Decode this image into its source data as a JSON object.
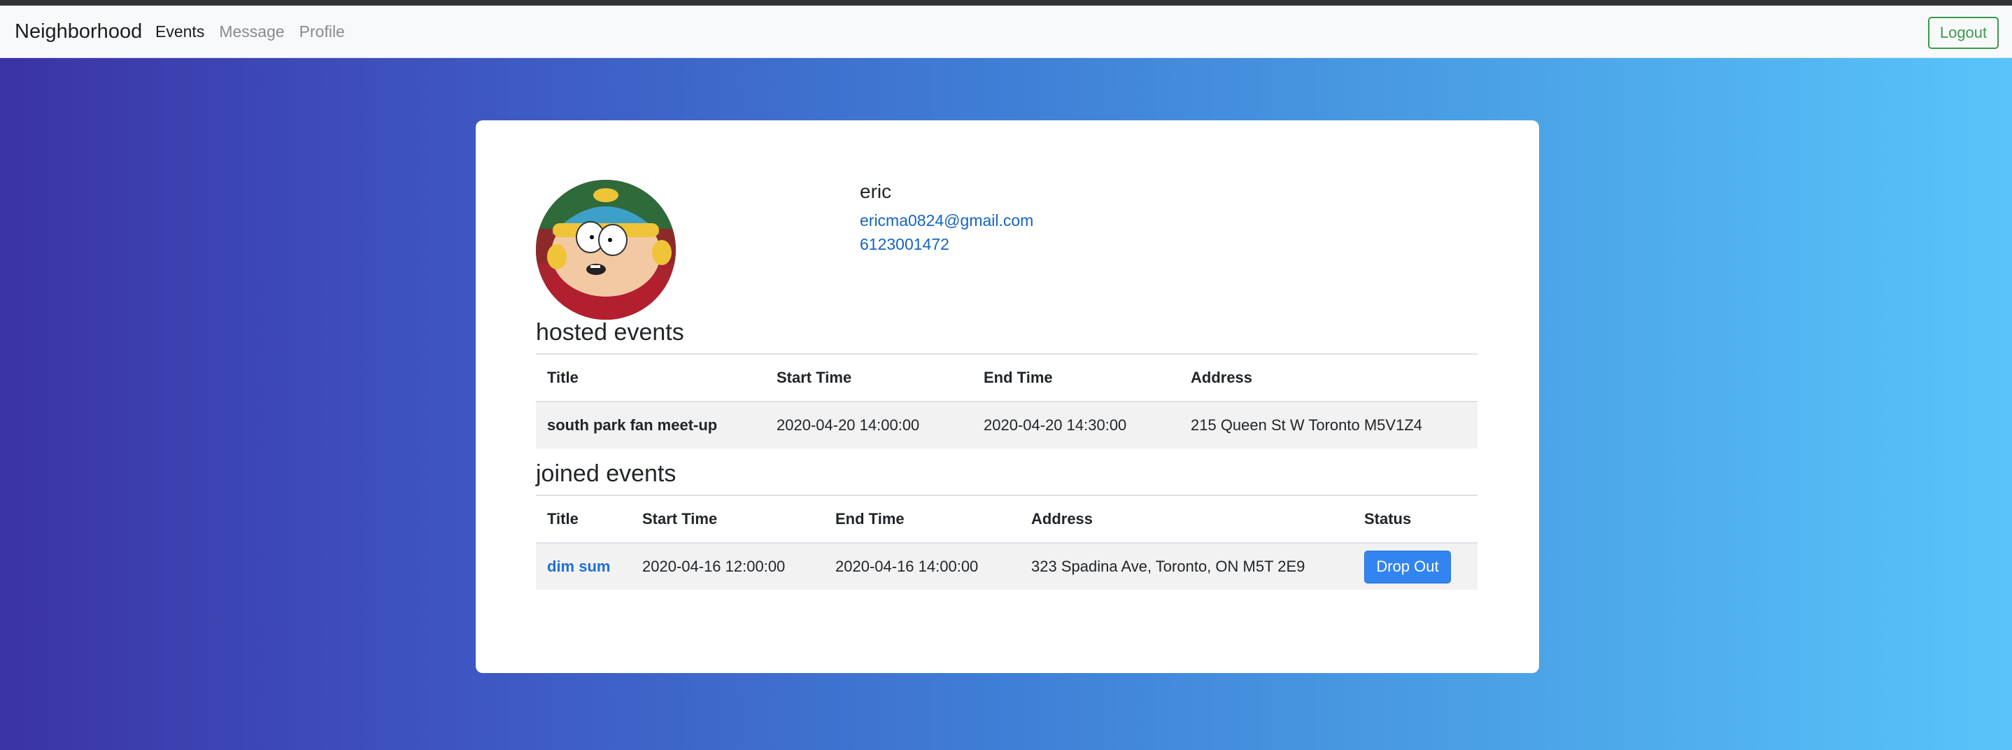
{
  "navbar": {
    "brand": "Neighborhood",
    "links": [
      {
        "label": "Events",
        "active": true
      },
      {
        "label": "Message",
        "active": false
      },
      {
        "label": "Profile",
        "active": false
      }
    ],
    "logout_label": "Logout"
  },
  "colors": {
    "gradient_start": "#3b33a6",
    "gradient_end": "#58c4fa",
    "link": "#1565c0",
    "primary_button": "#3284f0",
    "logout_border": "#3c9b4e"
  },
  "profile": {
    "avatar_icon": "cartoon-avatar",
    "name": "eric",
    "email": "ericma0824@gmail.com",
    "phone": "6123001472"
  },
  "hosted": {
    "heading": "hosted events",
    "columns": [
      "Title",
      "Start Time",
      "End Time",
      "Address"
    ],
    "rows": [
      {
        "title": "south park fan meet-up",
        "start": "2020-04-20 14:00:00",
        "end": "2020-04-20 14:30:00",
        "address": "215 Queen St W Toronto M5V1Z4"
      }
    ]
  },
  "joined": {
    "heading": "joined events",
    "columns": [
      "Title",
      "Start Time",
      "End Time",
      "Address",
      "Status"
    ],
    "rows": [
      {
        "title": "dim sum",
        "start": "2020-04-16 12:00:00",
        "end": "2020-04-16 14:00:00",
        "address": "323 Spadina Ave, Toronto, ON M5T 2E9",
        "status_button": "Drop Out"
      }
    ]
  }
}
